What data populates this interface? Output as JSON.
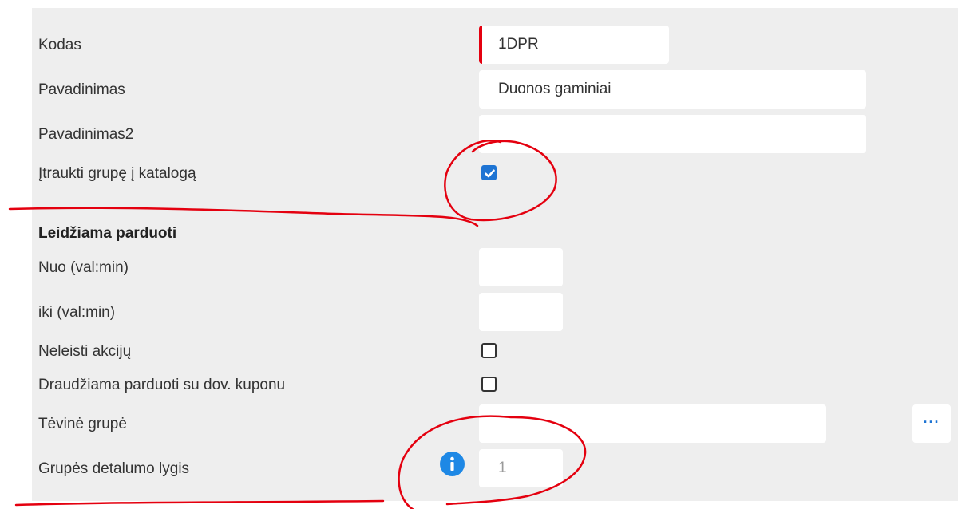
{
  "form": {
    "code": {
      "label": "Kodas",
      "value": "1DPR"
    },
    "name": {
      "label": "Pavadinimas",
      "value": "Duonos gaminiai"
    },
    "name2": {
      "label": "Pavadinimas2",
      "value": ""
    },
    "include_in_catalog": {
      "label": "Įtraukti grupę į katalogą",
      "checked": true
    },
    "sale_allowed": {
      "heading": "Leidžiama parduoti",
      "from": {
        "label": "Nuo (val:min)",
        "value": ""
      },
      "to": {
        "label": "iki (val:min)",
        "value": ""
      }
    },
    "no_promotions": {
      "label": "Neleisti akcijų",
      "checked": false
    },
    "no_discount_coupon": {
      "label": "Draudžiama parduoti su dov. kuponu",
      "checked": false
    },
    "parent_group": {
      "label": "Tėvinė grupė",
      "value": "",
      "lookup_label": "···"
    },
    "detail_level": {
      "label": "Grupės detalumo lygis",
      "value": "1",
      "info_icon": "info-icon"
    }
  },
  "colors": {
    "panel": "#eeeeee",
    "accent": "#1e74d3",
    "required_marker": "#e4000f",
    "annotation": "#e4000f"
  }
}
